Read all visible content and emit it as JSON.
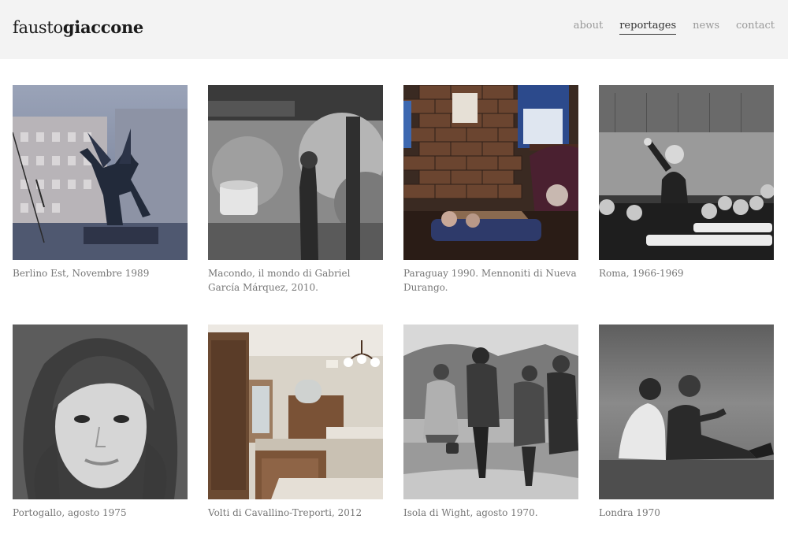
{
  "brand": {
    "first": "fausto",
    "last": "giaccone"
  },
  "nav": [
    {
      "label": "about",
      "active": false
    },
    {
      "label": "reportages",
      "active": true
    },
    {
      "label": "news",
      "active": false
    },
    {
      "label": "contact",
      "active": false
    }
  ],
  "reportages": [
    {
      "caption": "Berlino Est, Novembre 1989"
    },
    {
      "caption": "Macondo, il mondo di Gabriel García Márquez, 2010."
    },
    {
      "caption": "Paraguay 1990. Mennoniti di Nueva Durango."
    },
    {
      "caption": "Roma, 1966-1969"
    },
    {
      "caption": "Portogallo, agosto 1975"
    },
    {
      "caption": "Volti di Cavallino-Treporti, 2012"
    },
    {
      "caption": "Isola di Wight, agosto 1970."
    },
    {
      "caption": "Londra 1970"
    }
  ]
}
